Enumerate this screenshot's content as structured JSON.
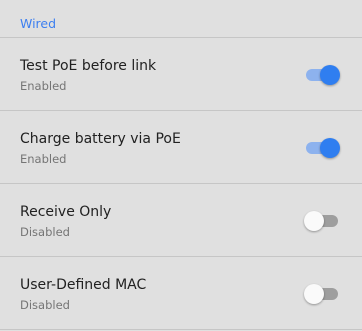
{
  "section": {
    "title": "Wired"
  },
  "settings": [
    {
      "title": "Test PoE before link",
      "status": "Enabled",
      "on": true
    },
    {
      "title": "Charge battery via PoE",
      "status": "Enabled",
      "on": true
    },
    {
      "title": "Receive Only",
      "status": "Disabled",
      "on": false
    },
    {
      "title": "User-Defined MAC",
      "status": "Disabled",
      "on": false
    }
  ],
  "colors": {
    "accent": "#2f7ef0",
    "section_header": "#3d7ff0",
    "background": "#e0e0e0"
  }
}
